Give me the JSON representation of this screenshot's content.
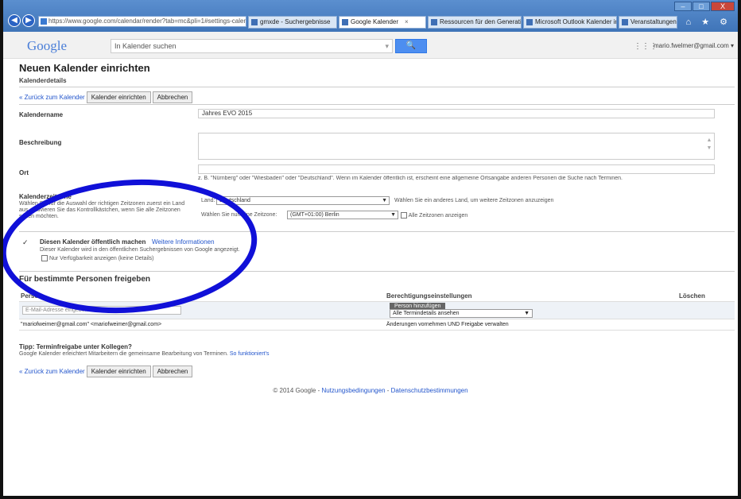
{
  "browser": {
    "url": "https://www.google.com/calendar/render?tab=mc&pli=1#settings-calendar_10",
    "tabs": [
      {
        "label": "gmxde - Suchergebnisse",
        "active": false
      },
      {
        "label": "Google Kalender",
        "active": true
      },
      {
        "label": "Ressourcen für den Generation ...",
        "active": false
      },
      {
        "label": "Microsoft Outlook Kalender in G...",
        "active": false
      },
      {
        "label": "Veranstaltungen",
        "active": false
      }
    ],
    "tab_close": "×",
    "window_controls": {
      "minimize": "–",
      "maximize": "□",
      "close": "X"
    },
    "toolbar_icons": "⌂ ★ ⚙",
    "back_glyph": "◀",
    "forward_glyph": "▶"
  },
  "google_header": {
    "logo": "Google",
    "search_placeholder": "In Kalender suchen",
    "search_dropdown": "▾",
    "search_button": "🔍",
    "apps_glyph": "⋮⋮⋮",
    "account": "mario.fwelmer@gmail.com ▾"
  },
  "page": {
    "title": "Neuen Kalender einrichten",
    "subtitle": "Kalenderdetails",
    "back_link": "« Zurück zum Kalender",
    "create_button": "Kalender einrichten",
    "cancel_button": "Abbrechen",
    "fields": {
      "name_label": "Kalendername",
      "name_value": "Jahres EVO 2015",
      "description_label": "Beschreibung",
      "location_label": "Ort",
      "location_hint": "z. B. \"Nürnberg\" oder \"Wiesbaden\" oder \"Deutschland\". Wenn im Kalender öffentlich ist, erscheint eine allgemeine Ortsangabe anderen Personen die Suche nach Terminen.",
      "timezone_label": "Kalenderzeitzone",
      "timezone_desc": "Wählen Sie für die Auswahl der richtigen Zeitzonen zuerst ein Land aus. Aktivieren Sie das Kontrollkästchen, wenn Sie alle Zeitzonen sehen möchten.",
      "country_label": "Land:",
      "country_value": "Deutschland",
      "country_hint": "Wählen Sie ein anderes Land, um weitere Zeitzonen anzuzeigen",
      "tz_label": "Wählen Sie nun eine Zeitzone:",
      "tz_value": "(GMT+01:00) Berlin",
      "show_all_tz": "Alle Zeitzonen anzeigen",
      "public_check": "✓",
      "public_label": "Diesen Kalender öffentlich machen",
      "public_more": "Weitere Informationen",
      "public_desc": "Dieser Kalender wird in den öffentlichen Suchergebnissen von Google angezeigt.",
      "freebusy_label": "Nur Verfügbarkeit anzeigen (keine Details)"
    },
    "share_section": {
      "title": "Für bestimmte Personen freigeben",
      "col_person": "Person",
      "col_permission": "Berechtigungseinstellungen",
      "col_delete": "Löschen",
      "email_placeholder": "E-Mail-Adresse eingeben",
      "add_person": "Person hinzufügen",
      "perm_default": "Alle Termindetails ansehen",
      "person_email": "\"mariofweimer@gmail.com\" <mariofweimer@gmail.com>",
      "person_permission": "Änderungen vornehmen UND Freigabe verwalten"
    },
    "tip_title": "Tipp: Terminfreigabe unter Kollegen?",
    "tip_text": "Google Kalender erleichtert Mitarbeitern die gemeinsame Bearbeitung von Terminen.",
    "tip_link": "So funktioniert's",
    "footer_text": "© 2014 Google - ",
    "footer_terms": "Nutzungsbedingungen",
    "footer_sep": " - ",
    "footer_privacy": "Datenschutzbestimmungen"
  },
  "colors": {
    "annotation": "#1010d8",
    "link": "#2255cc"
  }
}
